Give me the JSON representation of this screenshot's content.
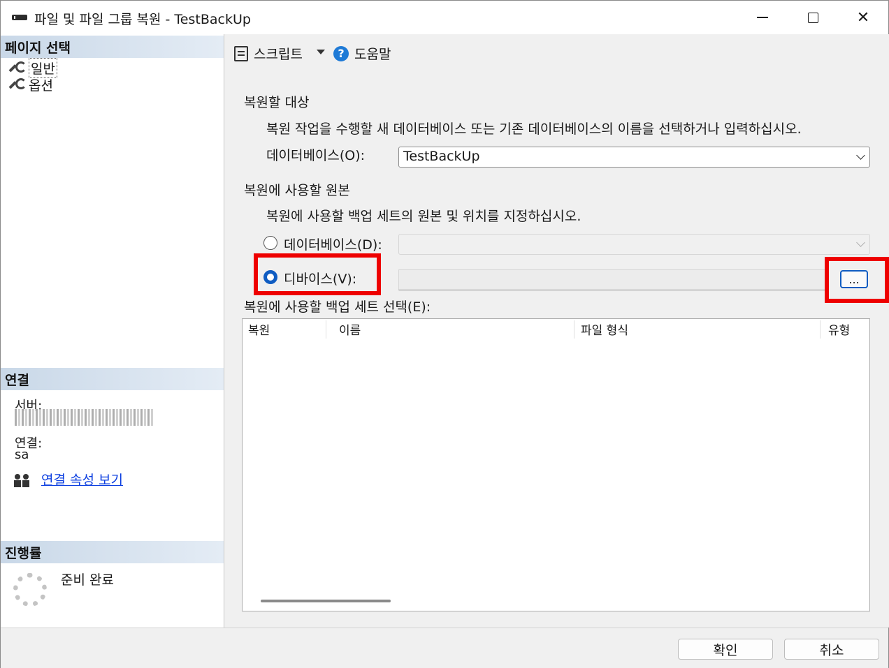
{
  "window": {
    "title": "파일 및 파일 그룹 복원 - TestBackUp",
    "minimize_label": "—",
    "close_label": "✕"
  },
  "left": {
    "page_select_header": "페이지 선택",
    "nav_items": [
      {
        "label": "일반",
        "icon": "wrench-icon"
      },
      {
        "label": "옵션",
        "icon": "wrench-icon"
      }
    ],
    "connection_header": "연결",
    "server_label": "서버:",
    "connection_label": "연결:",
    "connection_value": "sa",
    "view_props_link": "연결 속성 보기",
    "progress_header": "진행률",
    "progress_status": "준비 완료"
  },
  "toolbar": {
    "script_label": "스크립트",
    "help_label": "도움말"
  },
  "restore_target": {
    "heading": "복원할 대상",
    "description": "복원 작업을 수행할 새 데이터베이스 또는 기존 데이터베이스의 이름을 선택하거나 입력하십시오.",
    "database_label": "데이터베이스(O):",
    "database_value": "TestBackUp"
  },
  "restore_source": {
    "heading": "복원에 사용할 원본",
    "description": "복원에 사용할 백업 세트의 원본 및 위치를 지정하십시오.",
    "database_radio_label": "데이터베이스(D):",
    "device_radio_label": "디바이스(V):",
    "browse_label": "...",
    "selected_option": "device"
  },
  "backup_sets": {
    "label": "복원에 사용할 백업 세트 선택(E):",
    "columns": [
      "복원",
      "이름",
      "파일 형식",
      "유형"
    ],
    "rows": []
  },
  "buttons": {
    "ok": "확인",
    "cancel": "취소"
  },
  "colors": {
    "highlight": "#ee0000",
    "accent": "#0f5cc2",
    "link": "#0b3ee0"
  }
}
